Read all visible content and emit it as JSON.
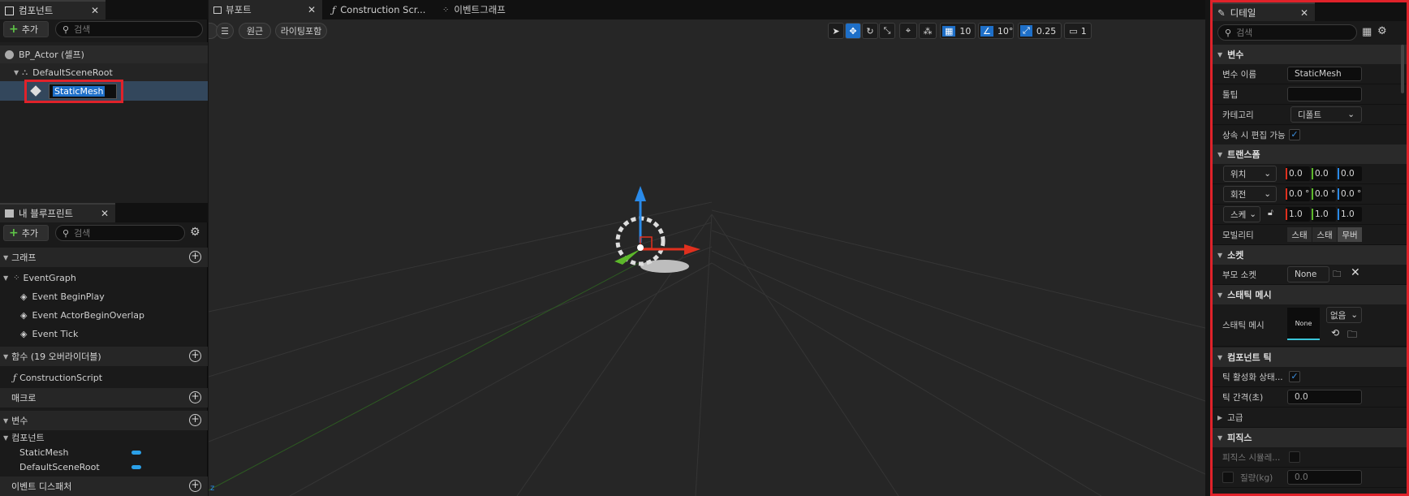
{
  "components_panel": {
    "tab_label": "컴포넌트",
    "add_label": "추가",
    "search_placeholder": "검색",
    "tree": {
      "root": "BP_Actor (셀프)",
      "scene_root": "DefaultSceneRoot",
      "selected_item": "StaticMesh"
    }
  },
  "blueprint_panel": {
    "tab_label": "내 블루프린트",
    "add_label": "추가",
    "search_placeholder": "검색",
    "sections": {
      "graph": "그래프",
      "functions": "함수 (19 오버라이더블)",
      "macros": "매크로",
      "variables": "변수",
      "dispatchers": "이벤트 디스패처"
    },
    "event_graph": "EventGraph",
    "events": [
      "Event BeginPlay",
      "Event ActorBeginOverlap",
      "Event Tick"
    ],
    "construction_script": "ConstructionScript",
    "components_category": "컴포넌트",
    "component_vars": [
      "StaticMesh",
      "DefaultSceneRoot"
    ],
    "var_color": "#2ba0e8"
  },
  "viewport": {
    "tabs": [
      "뷰포트",
      "Construction Scr...",
      "이벤트그래프"
    ],
    "perspective_button": "원근",
    "lighting_button": "라이팅포함",
    "grid_snap": "10",
    "rotation_snap": "10°",
    "scale_snap": "0.25",
    "camera_speed": "1",
    "axis_colors": {
      "x": "#e0301e",
      "y": "#5cb82a",
      "z": "#2a8ae8"
    }
  },
  "details": {
    "tab_label": "디테일",
    "search_placeholder": "검색",
    "variable_section": "변수",
    "variable_name_label": "변수 이름",
    "variable_name_value": "StaticMesh",
    "tooltip_label": "툴팁",
    "category_label": "카테고리",
    "category_value": "디폴트",
    "editable_label": "상속 시 편집 가능",
    "transform_section": "트랜스폼",
    "location_label": "위치",
    "location": [
      "0.0",
      "0.0",
      "0.0"
    ],
    "rotation_label": "회전",
    "rotation": [
      "0.0 °",
      "0.0 °",
      "0.0 °"
    ],
    "scale_label": "스케",
    "scale": [
      "1.0",
      "1.0",
      "1.0"
    ],
    "mobility_label": "모빌리티",
    "mobility_options": [
      "스태",
      "스태",
      "무버"
    ],
    "sockets_section": "소켓",
    "parent_socket_label": "부모 소켓",
    "parent_socket_value": "None",
    "static_mesh_section": "스태틱 메시",
    "static_mesh_label": "스태틱 메시",
    "mesh_thumbnail": "None",
    "mesh_value": "없음",
    "tick_section": "컴포넌트 틱",
    "tick_enabled_label": "틱 활성화 상태...",
    "tick_interval_label": "틱 간격(초)",
    "tick_interval_value": "0.0",
    "advanced_label": "고급",
    "physics_section": "피직스",
    "simulate_label": "피직스 시뮬레...",
    "mass_label": "질량(kg)",
    "mass_value": "0.0"
  }
}
